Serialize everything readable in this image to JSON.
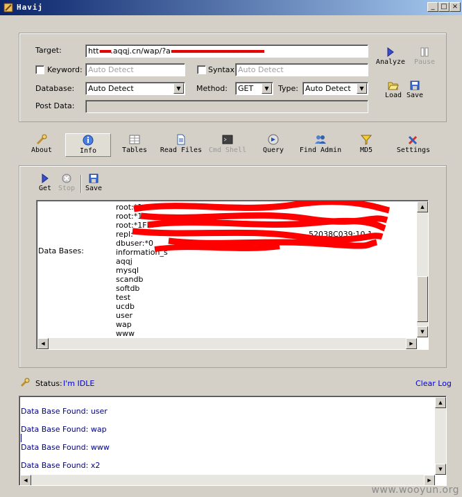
{
  "window": {
    "title": "Havij",
    "min": "_",
    "max": "□",
    "close": "×"
  },
  "target": {
    "label": "Target:",
    "value": "htt",
    "value_tail": ".aqqj.cn/wap/?a"
  },
  "keyword": {
    "label": "Keyword:",
    "placeholder": "Auto Detect"
  },
  "syntax": {
    "label": "Syntax:",
    "placeholder": "Auto Detect"
  },
  "database": {
    "label": "Database:",
    "value": "Auto Detect"
  },
  "method": {
    "label": "Method:",
    "value": "GET"
  },
  "type": {
    "label": "Type:",
    "value": "Auto Detect"
  },
  "post_data": {
    "label": "Post Data:"
  },
  "actions": {
    "analyze": "Analyze",
    "pause": "Pause",
    "load": "Load",
    "save": "Save"
  },
  "tabs": {
    "about": "About",
    "info": "Info",
    "tables": "Tables",
    "read_files": "Read Files",
    "cmd_shell": "Cmd Shell",
    "query": "Query",
    "find_admin": "Find Admin",
    "md5": "MD5",
    "settings": "Settings"
  },
  "subtoolbar": {
    "get": "Get",
    "stop": "Stop",
    "save": "Save"
  },
  "results": {
    "label": "Data Bases:",
    "redacted_rows": [
      "root:*1",
      "root:*1F",
      "root:*1FEF",
      "repl:",
      "dbuser:*0"
    ],
    "partial_text": "52038C039:10.1",
    "partial_text2": "information_s",
    "items": [
      "aqqj",
      "mysql",
      "scandb",
      "softdb",
      "test",
      "ucdb",
      "user",
      "wap",
      "www"
    ]
  },
  "status": {
    "label": "Status:",
    "value": "I'm IDLE",
    "clear_log": "Clear Log"
  },
  "log": {
    "lines": [
      "Data Base Found: user",
      "Data Base Found: wap",
      "Data Base Found: www",
      "Data Base Found: x2"
    ]
  },
  "watermark": "www.wooyun.org"
}
